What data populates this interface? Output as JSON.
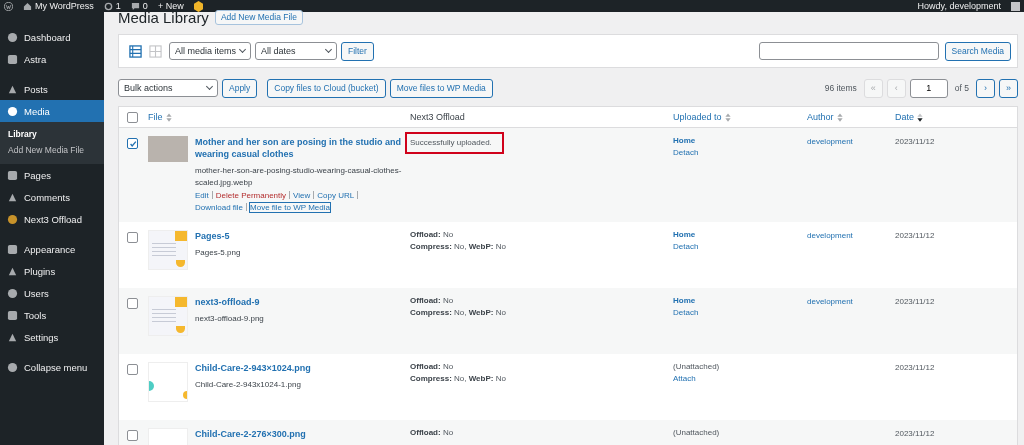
{
  "admin_bar": {
    "site": "My WordPress",
    "updates": "1",
    "comments": "0",
    "new": "+ New",
    "greeting": "Howdy, development"
  },
  "sidebar": {
    "items": [
      {
        "label": "Dashboard",
        "selected": false
      },
      {
        "label": "Astra",
        "selected": false
      },
      {
        "label": "Posts",
        "selected": false
      },
      {
        "label": "Media",
        "selected": true,
        "children": [
          {
            "label": "Library",
            "selected": true
          },
          {
            "label": "Add New Media File",
            "selected": false
          }
        ]
      },
      {
        "label": "Pages",
        "selected": false
      },
      {
        "label": "Comments",
        "selected": false
      },
      {
        "label": "Next3 Offload",
        "selected": false
      },
      {
        "label": "Appearance",
        "selected": false
      },
      {
        "label": "Plugins",
        "selected": false
      },
      {
        "label": "Users",
        "selected": false
      },
      {
        "label": "Tools",
        "selected": false
      },
      {
        "label": "Settings",
        "selected": false
      },
      {
        "label": "Collapse menu",
        "selected": false
      }
    ]
  },
  "page": {
    "title": "Media Library",
    "add_button": "Add New Media File"
  },
  "filter_bar": {
    "view_modes": [
      {
        "kind": "list",
        "selected": true
      },
      {
        "kind": "grid",
        "selected": false
      }
    ],
    "type_filter": "All media items",
    "date_filter": "All dates",
    "filter_button": "Filter",
    "search_button": "Search Media"
  },
  "bulk_bar": {
    "bulk_actions": "Bulk actions",
    "apply": "Apply",
    "copy_button": "Copy files to Cloud (bucket)",
    "move_button": "Move files to WP Media",
    "count": "96 items",
    "first": "«",
    "prev": "‹",
    "page": "1",
    "of": "of 5",
    "next": "›",
    "last": "»"
  },
  "table": {
    "select_all_checked": false,
    "columns": [
      {
        "label": "File",
        "sortable": true,
        "sorted": false
      },
      {
        "label": "Next3 Offload",
        "sortable": false,
        "sorted": false
      },
      {
        "label": "Uploaded to",
        "sortable": true,
        "sorted": false
      },
      {
        "label": "Author",
        "sortable": true,
        "sorted": false
      },
      {
        "label": "Date",
        "sortable": true,
        "sorted": true
      }
    ],
    "rows": [
      {
        "checked": true,
        "thumbnail": {
          "kind": "photo"
        },
        "title": "Mother and her son are posing in the studio and wearing casual clothes",
        "filename": "mother-her-son-are-posing-studio-wearing-casual-clothes-scaled.jpg.webp",
        "actions": [
          {
            "label": "Edit",
            "kind": "link",
            "focused": false
          },
          {
            "label": "Delete Permanently",
            "kind": "delete",
            "focused": false
          },
          {
            "label": "View",
            "kind": "link",
            "focused": false
          },
          {
            "label": "Copy URL",
            "kind": "link",
            "focused": false
          },
          {
            "label": "Download file",
            "kind": "link",
            "focused": false
          },
          {
            "label": "Move file to WP Media",
            "kind": "link",
            "focused": true
          }
        ],
        "offload": {
          "kind": "status",
          "text": "Successfully uploaded.",
          "highlighted": true
        },
        "uploaded_to": {
          "attached": true,
          "text": "Home",
          "action": "Detach"
        },
        "author": "development",
        "date": "2023/11/12"
      },
      {
        "checked": false,
        "thumbnail": {
          "kind": "screenshot"
        },
        "title": "Pages-5",
        "filename": "Pages-5.png",
        "offload": {
          "kind": "details",
          "lines": [
            "**Offload:** No",
            "**Compress:** No, **WebP:** No"
          ]
        },
        "uploaded_to": {
          "attached": true,
          "text": "Home",
          "action": "Detach"
        },
        "author": "development",
        "date": "2023/11/12"
      },
      {
        "checked": false,
        "thumbnail": {
          "kind": "screenshot"
        },
        "title": "next3-offload-9",
        "filename": "next3-offload-9.png",
        "offload": {
          "kind": "details",
          "lines": [
            "**Offload:** No",
            "**Compress:** No, **WebP:** No"
          ]
        },
        "uploaded_to": {
          "attached": true,
          "text": "Home",
          "action": "Detach"
        },
        "author": "development",
        "date": "2023/11/12"
      },
      {
        "checked": false,
        "thumbnail": {
          "kind": "blank"
        },
        "title": "Child-Care-2-943×1024.png",
        "filename": "Child-Care-2-943x1024-1.png",
        "offload": {
          "kind": "details",
          "lines": [
            "**Offload:** No",
            "**Compress:** No, **WebP:** No"
          ]
        },
        "uploaded_to": {
          "attached": false,
          "text": "(Unattached)",
          "action": "Attach"
        },
        "date": "2023/11/12"
      },
      {
        "checked": false,
        "thumbnail": {
          "kind": "blank"
        },
        "title": "Child-Care-2-276×300.png",
        "offload": {
          "kind": "details",
          "lines": [
            "**Offload:** No"
          ]
        },
        "uploaded_to": {
          "attached": false,
          "text": "(Unattached)"
        },
        "date": "2023/11/12"
      }
    ]
  }
}
